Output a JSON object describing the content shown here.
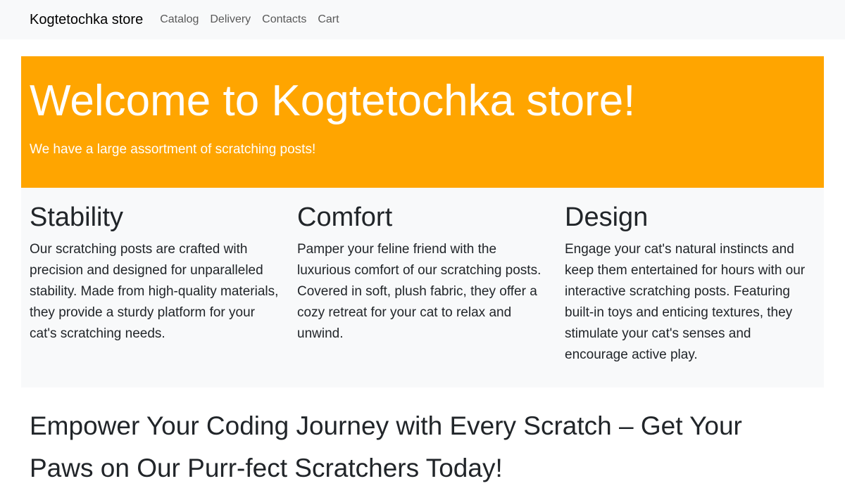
{
  "navbar": {
    "brand": "Kogtetochka store",
    "links": [
      "Catalog",
      "Delivery",
      "Contacts",
      "Cart"
    ]
  },
  "hero": {
    "title": "Welcome to Kogtetochka store!",
    "subtitle": "We have a large assortment of scratching posts!",
    "background_color": "#ffa500"
  },
  "features": [
    {
      "title": "Stability",
      "text": "Our scratching posts are crafted with precision and designed for unparalleled stability. Made from high-quality materials, they provide a sturdy platform for your cat's scratching needs."
    },
    {
      "title": "Comfort",
      "text": "Pamper your feline friend with the luxurious comfort of our scratching posts. Covered in soft, plush fabric, they offer a cozy retreat for your cat to relax and unwind."
    },
    {
      "title": "Design",
      "text": "Engage your cat's natural instincts and keep them entertained for hours with our interactive scratching posts. Featuring built-in toys and enticing textures, they stimulate your cat's senses and encourage active play."
    }
  ],
  "tagline": "Empower Your Coding Journey with Every Scratch – Get Your Paws on Our Purr-fect Scratchers Today!"
}
